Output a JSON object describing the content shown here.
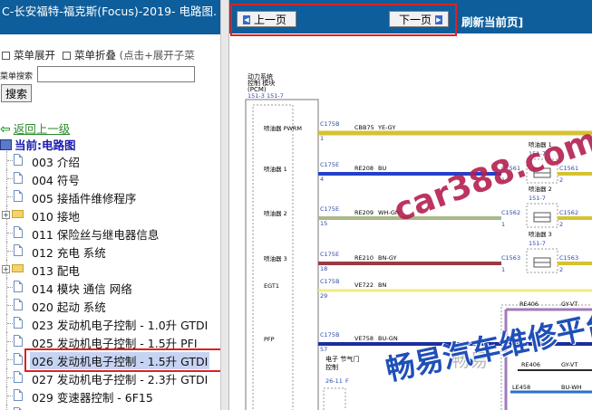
{
  "left": {
    "title": "C-长安福特-福克斯(Focus)-2019- 电路图.",
    "menu_expand": "菜单展开",
    "menu_collapse": "菜单折叠",
    "menu_hint": "(点击+展开子菜",
    "search_label": "菜单搜索",
    "search_value": "",
    "search_button": "搜索",
    "back_link": "返回上一级",
    "current": "当前:电路图",
    "tree": [
      {
        "label": "003 介绍",
        "type": "doc"
      },
      {
        "label": "004 符号",
        "type": "doc"
      },
      {
        "label": "005 接插件维修程序",
        "type": "doc"
      },
      {
        "label": "010 接地",
        "type": "folder"
      },
      {
        "label": "011 保险丝与继电器信息",
        "type": "doc"
      },
      {
        "label": "012 充电 系统",
        "type": "doc"
      },
      {
        "label": "013 配电",
        "type": "folder"
      },
      {
        "label": "014 模块 通信 网络",
        "type": "doc"
      },
      {
        "label": "020 起动 系统",
        "type": "doc"
      },
      {
        "label": "023 发动机电子控制 - 1.0升 GTDI",
        "type": "doc"
      },
      {
        "label": "025 发动机电子控制 - 1.5升 PFI",
        "type": "doc"
      },
      {
        "label": "026 发动机电子控制 - 1.5升 GTDI",
        "type": "doc",
        "selected": true
      },
      {
        "label": "027 发动机电子控制 - 2.3升 GTDI",
        "type": "doc"
      },
      {
        "label": "029 变速器控制 - 6F15",
        "type": "doc"
      },
      {
        "label": "030 变速器控制",
        "type": "doc"
      }
    ]
  },
  "right": {
    "prev_button": "上一页",
    "next_button": "下一页",
    "refresh": "刷新当前页]"
  },
  "diagram": {
    "module_label": [
      "动力系统",
      "控制 模块",
      "(PCM)"
    ],
    "module_pins": "151-3   151-7",
    "rows": [
      {
        "label": "喷油器 PWRM",
        "pin": "1",
        "connector": "C175B",
        "wire": "CBB75",
        "color_code": "YE-GY"
      },
      {
        "label": "喷油器 1",
        "pin": "4",
        "connector": "C175E",
        "wire": "RE208",
        "color_code": "BU"
      },
      {
        "label": "喷油器 2",
        "pin": "15",
        "connector": "C175E",
        "wire": "RE209",
        "color_code": "WH-GN"
      },
      {
        "label": "喷油器 3",
        "pin": "18",
        "connector": "C175E",
        "wire": "RE210",
        "color_code": "BN-GY"
      },
      {
        "label": "EGT1",
        "pin": "29",
        "connector": "C175B",
        "wire": "VE722",
        "color_code": "BN"
      },
      {
        "label": "PFP",
        "pin": "57",
        "connector": "C175B",
        "wire": "VE758",
        "color_code": "BU-GN"
      }
    ],
    "injectors": [
      {
        "name": "喷油器 1",
        "pin": "151-7",
        "conn_left": "C1561",
        "conn_right": "C1561",
        "pin_left": "1",
        "pin_right": "2"
      },
      {
        "name": "喷油器 2",
        "pin": "151-7",
        "conn_left": "C1562",
        "conn_right": "C1562",
        "pin_left": "1",
        "pin_right": "2"
      },
      {
        "name": "喷油器 3",
        "pin": "151-7",
        "conn_left": "C1563",
        "conn_right": "C1563",
        "pin_left": "1",
        "pin_right": "2"
      }
    ],
    "extra_labels": {
      "elec_throttle": [
        "电子 节气门",
        "控制"
      ],
      "etc_pin": "26-11",
      "etc_pin2": "F",
      "re406": "RE406",
      "gy_vt": "GY-VT",
      "re406b": "RE406",
      "gy_vt_b": "GY-VT",
      "le458": "LE458",
      "bu_wh": "BU-WH",
      "re4xx": "RE4"
    },
    "watermark_site": "car388.com",
    "watermark_cn": "畅易汽车维修平台",
    "watermark_small": "畅易"
  }
}
